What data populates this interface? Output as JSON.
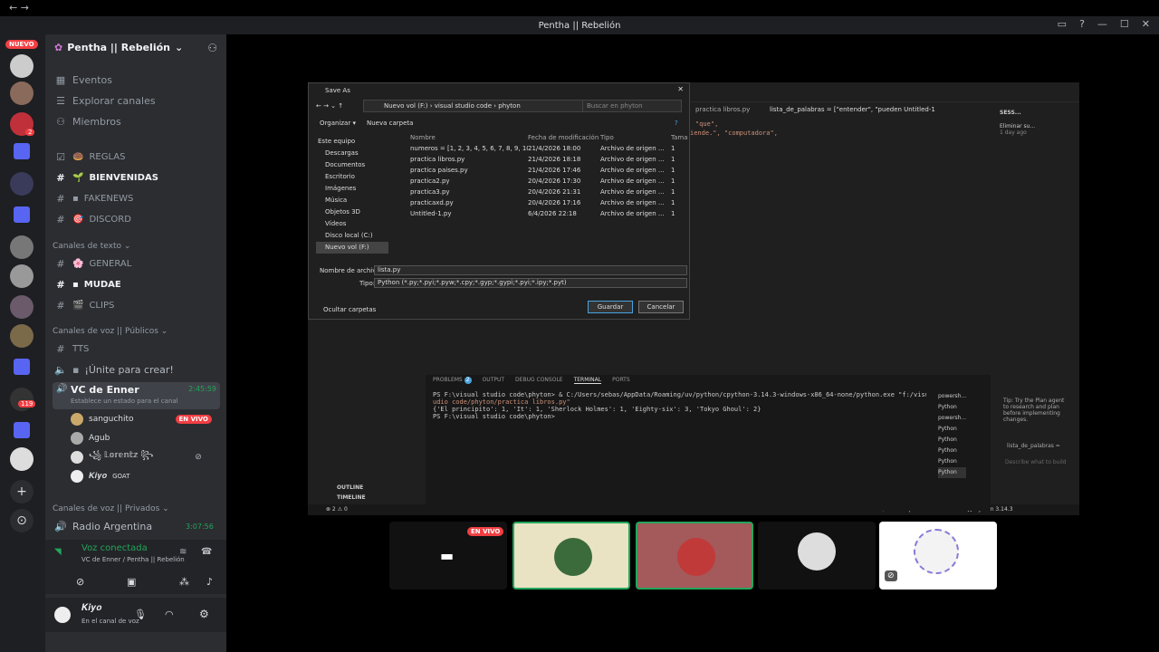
{
  "window": {
    "title": "Pentha || Rebelión"
  },
  "rail": {
    "new_badge": "NUEVO",
    "badge1": "2",
    "badge2": "119"
  },
  "guild": {
    "name": "Pentha || Rebelión"
  },
  "nav": {
    "events": "Eventos",
    "explore": "Explorar canales",
    "members": "Miembros"
  },
  "channels": {
    "reglas": "REGLAS",
    "bienvenidas": "BIENVENIDAS",
    "fakenews": "FAKENEWS",
    "discord": "DISCORD",
    "cat_text": "Canales de texto",
    "general": "GENERAL",
    "mudae": "MUDAE",
    "clips": "CLIPS",
    "cat_voice": "Canales de voz || Públicos",
    "tts": "TTS",
    "unite": "¡Únite para crear!",
    "vc_name": "VC de Enner",
    "vc_time": "2:45:59",
    "vc_status": "Establece un estado para el canal",
    "cat_private": "Canales de voz || Privados",
    "radio": "Radio Argentina",
    "radio_time": "3:07:56"
  },
  "voice_users": [
    {
      "name": "sanguchito",
      "live": "EN VIVO"
    },
    {
      "name": "Agub"
    },
    {
      "name": "꧁ 𝕃𝕠𝕣𝕖𝕟𝕥𝕫 ꧂"
    },
    {
      "name": "𝑲𝒊𝒚𝒐",
      "tag": "GOAT"
    }
  ],
  "voice_panel": {
    "status": "Voz conectada",
    "channel": "VC de Enner / Pentha || Rebelión"
  },
  "user_panel": {
    "name": "𝑲𝒊𝒚𝒐",
    "status": "En el canal de voz"
  },
  "dialog": {
    "title": "Save As",
    "path": "Nuevo vol (F:)  ›  visual studio code  ›  phyton",
    "search": "Buscar en phyton",
    "organize": "Organizar ▾",
    "new_folder": "Nueva carpeta",
    "tree": [
      "Este equipo",
      "Descargas",
      "Documentos",
      "Escritorio",
      "Imágenes",
      "Música",
      "Objetos 3D",
      "Vídeos",
      "Disco local (C:)",
      "Nuevo vol (F:)"
    ],
    "columns": [
      "Nombre",
      "Fecha de modificación",
      "Tipo",
      "Tamaño"
    ],
    "files": [
      {
        "name": "numeros = [1, 2, 3, 4, 5, 6, 7, 8, 9, 10].py",
        "date": "21/4/2026 18:00",
        "type": "Archivo de origen ...",
        "size": "1"
      },
      {
        "name": "practica libros.py",
        "date": "21/4/2026 18:18",
        "type": "Archivo de origen ...",
        "size": "1"
      },
      {
        "name": "practica paises.py",
        "date": "21/4/2026 17:46",
        "type": "Archivo de origen ...",
        "size": "1"
      },
      {
        "name": "practica2.py",
        "date": "20/4/2026 17:30",
        "type": "Archivo de origen ...",
        "size": "1"
      },
      {
        "name": "practica3.py",
        "date": "20/4/2026 21:31",
        "type": "Archivo de origen ...",
        "size": "1"
      },
      {
        "name": "practicaxd.py",
        "date": "20/4/2026 17:16",
        "type": "Archivo de origen ...",
        "size": "1"
      },
      {
        "name": "Untitled-1.py",
        "date": "6/4/2026 22:18",
        "type": "Archivo de origen ...",
        "size": "1"
      }
    ],
    "filename_label": "Nombre de archivo:",
    "filename_value": "lista.py",
    "type_label": "Tipo:",
    "type_value": "Python (*.py;*.pyi;*.pyw;*.cpy;*.gyp;*.gypi;*.pyi;*.ipy;*.pyt)",
    "hide_folders": "Ocultar carpetas",
    "save": "Guardar",
    "cancel": "Cancelar"
  },
  "editor": {
    "tab1": "practica libros.py",
    "tab2": "lista_de_palabras = [\"entender\", \"pueden  Untitled-1",
    "code1": "\"que\",",
    "code2": "iende.\", \"computadora\","
  },
  "chat": {
    "title": "SESS...",
    "item": "Eliminar su...",
    "item_time": "1 day ago",
    "tip": "Tip: Try the Plan agent to research and plan before implementing changes.",
    "file": "lista_de_palabras =",
    "placeholder": "Describe what to build"
  },
  "panel_tabs": [
    "PROBLEMS",
    "OUTPUT",
    "DEBUG CONSOLE",
    "TERMINAL",
    "PORTS"
  ],
  "problems_count": "2",
  "terminal": {
    "line1": "PS F:\\visual studio code\\phyton> & C:/Users/sebas/AppData/Roaming/uv/python/cpython-3.14.3-windows-x86_64-none/python.exe \"f:/visual st",
    "line2": "udio code/phyton/practica libros.py\"",
    "line3": "{'El principito': 1, 'It': 1, 'Sherlock Holmes': 1, 'Eighty-six': 3, 'Tokyo Ghoul': 2}",
    "line4": "PS F:\\visual studio code\\phyton>"
  },
  "terminal_list": [
    "powersh...",
    "Python",
    "powersh...",
    "Python",
    "Python",
    "Python",
    "Python",
    "Python"
  ],
  "sidebar_bottom": [
    "OUTLINE",
    "TIMELINE"
  ],
  "status": {
    "left": "⊗ 2 ⚠ 0",
    "right": "Ln 6, Col 14   Spaces: 4   UTF-8   CRLF   {} Python   3.14.3"
  },
  "stream": {
    "live": "EN VIVO"
  },
  "colors": {
    "discord_bg": "#2b2d31",
    "rail_bg": "#1e1f22",
    "live_red": "#f23f43",
    "green": "#23a55a"
  }
}
